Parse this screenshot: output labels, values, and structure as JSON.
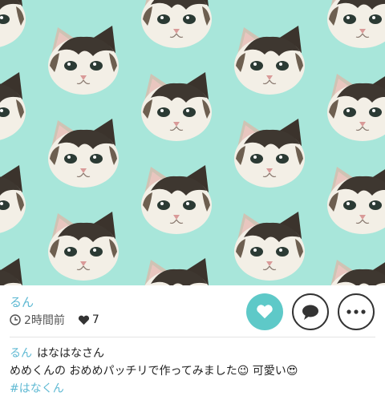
{
  "post": {
    "author": "るん",
    "time_ago": "2時間前",
    "like_count": "7",
    "pattern_background": "#a8e6da",
    "accent": "#5ec9c8"
  },
  "actions": {
    "like_icon": "heart-icon",
    "comment_icon": "speech-bubble-icon",
    "more_icon": "ellipsis-icon"
  },
  "comment": {
    "author": "るん",
    "line1": "はなはなさん",
    "line2": "めめくんの おめめパッチリで作ってみました",
    "emoji1": "😉",
    "after_emoji1": " 可愛い",
    "emoji2": "😍",
    "hashtag": "#はなくん"
  }
}
